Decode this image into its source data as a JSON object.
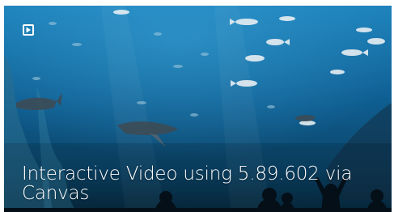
{
  "video": {
    "title": "Interactive Video using 5.89.602 via Canvas",
    "play_icon": "play-icon"
  },
  "colors": {
    "water_top": "#1a7ab1",
    "water_mid": "#0e5a8c",
    "water_bottom": "#0a3550",
    "text": "#ffffff"
  }
}
